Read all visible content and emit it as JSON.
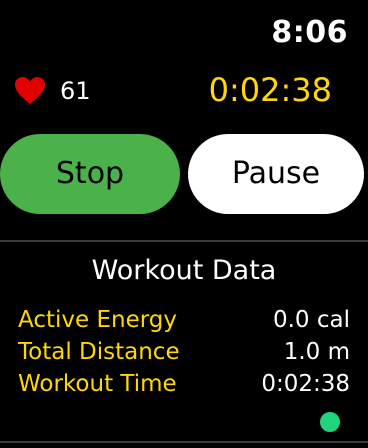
{
  "status": {
    "time": "8:06"
  },
  "heart": {
    "icon": "heart-icon",
    "rate": "61",
    "color": "#e00000"
  },
  "workout": {
    "elapsed": "0:02:38"
  },
  "buttons": {
    "stop_label": "Stop",
    "pause_label": "Pause"
  },
  "section": {
    "title": "Workout Data"
  },
  "data_rows": [
    {
      "label": "Active Energy",
      "value": "0.0 cal"
    },
    {
      "label": "Total Distance",
      "value": "1.0 m"
    },
    {
      "label": "Workout Time",
      "value": "0:02:38"
    }
  ],
  "indicator": {
    "color": "#1fd47a"
  },
  "colors": {
    "background": "#000000",
    "accent_yellow": "#ffd60a",
    "stop_green": "#4bb24b",
    "pause_white": "#ffffff"
  }
}
